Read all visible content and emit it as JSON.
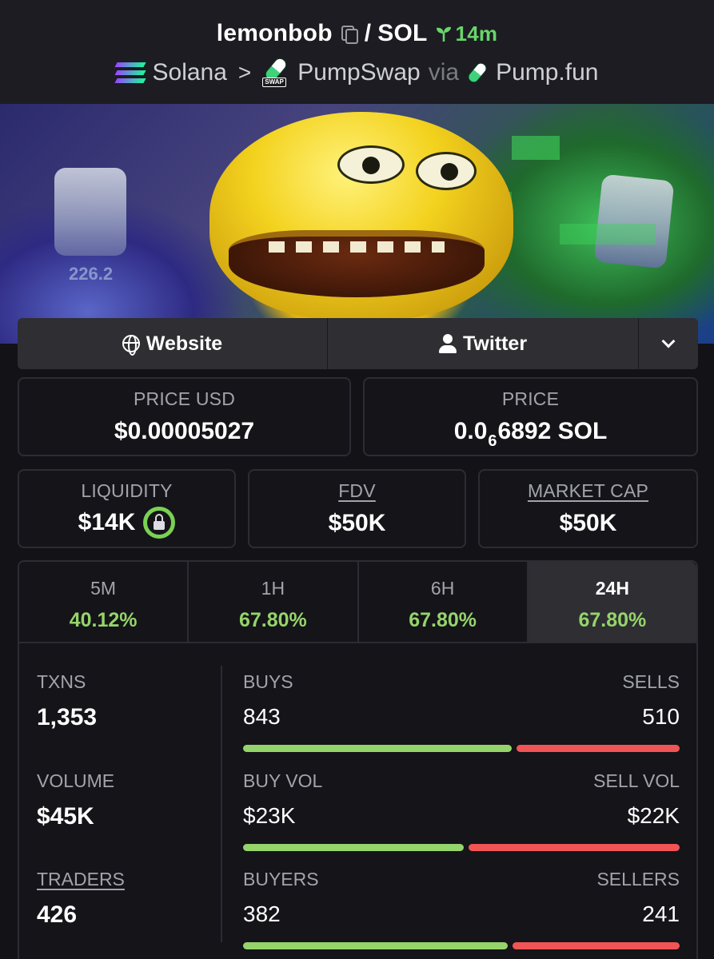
{
  "header": {
    "token": "lemonbob",
    "pair_sep": "/",
    "quote": "SOL",
    "age": "14m",
    "chain": "Solana",
    "dex": "PumpSwap",
    "dex_tag": "SWAP",
    "via": "via",
    "launchpad": "Pump.fun",
    "icons": [
      "copy-icon",
      "seedling-icon",
      "solana-logo-icon",
      "pumpswap-logo-icon",
      "pumpfun-pill-icon"
    ]
  },
  "banner": {
    "overlay_text": "226.2"
  },
  "links": {
    "website": "Website",
    "twitter": "Twitter"
  },
  "price": {
    "usd_label": "PRICE USD",
    "usd_value": "$0.00005027",
    "native_label": "PRICE",
    "native_prefix": "0.0",
    "native_subscript": "6",
    "native_rest": "6892 SOL"
  },
  "metrics": {
    "liquidity_label": "LIQUIDITY",
    "liquidity_value": "$14K",
    "fdv_label": "FDV",
    "fdv_value": "$50K",
    "mcap_label": "MARKET CAP",
    "mcap_value": "$50K"
  },
  "timeframes": [
    {
      "label": "5M",
      "change": "40.12%"
    },
    {
      "label": "1H",
      "change": "67.80%"
    },
    {
      "label": "6H",
      "change": "67.80%"
    },
    {
      "label": "24H",
      "change": "67.80%",
      "active": true
    }
  ],
  "stats": {
    "txns_label": "TXNS",
    "txns_value": "1,353",
    "volume_label": "VOLUME",
    "volume_value": "$45K",
    "traders_label": "TRADERS",
    "traders_value": "426",
    "buys_label": "BUYS",
    "buys_value": "843",
    "sells_label": "SELLS",
    "sells_value": "510",
    "buy_vol_label": "BUY VOL",
    "buy_vol_value": "$23K",
    "sell_vol_label": "SELL VOL",
    "sell_vol_value": "$22K",
    "buyers_label": "BUYERS",
    "buyers_value": "382",
    "sellers_label": "SELLERS",
    "sellers_value": "241",
    "buy_share_txns": 0.623,
    "buy_share_volume": 0.511,
    "buy_share_traders": 0.613
  },
  "colors": {
    "background": "#121217",
    "positive": "#95d46a",
    "negative": "#f05454",
    "age_green": "#69d56b"
  }
}
